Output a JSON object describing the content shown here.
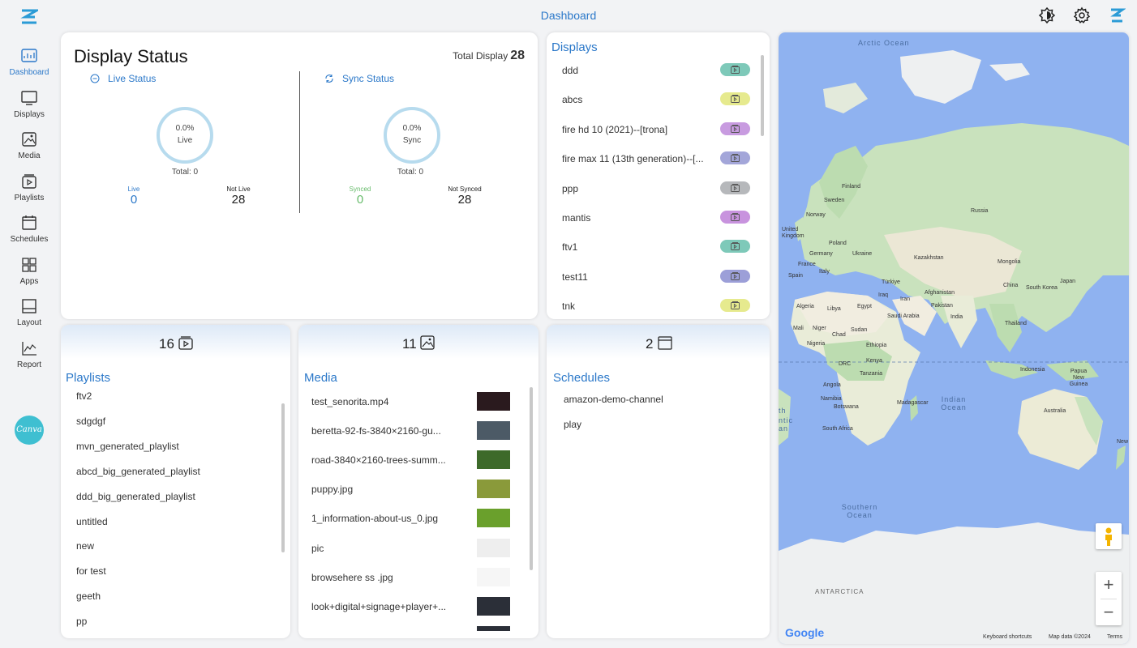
{
  "header": {
    "title": "Dashboard"
  },
  "sidebar": {
    "items": [
      {
        "label": "Dashboard"
      },
      {
        "label": "Displays"
      },
      {
        "label": "Media"
      },
      {
        "label": "Playlists"
      },
      {
        "label": "Schedules"
      },
      {
        "label": "Apps"
      },
      {
        "label": "Layout"
      },
      {
        "label": "Report"
      }
    ],
    "canva_label": "Canva"
  },
  "display_status": {
    "title": "Display Status",
    "total_label": "Total Display",
    "total_value": "28",
    "live": {
      "header": "Live Status",
      "gauge_pct": "0.0%",
      "gauge_label": "Live",
      "total": "Total: 0",
      "stat1_label": "Live",
      "stat1_value": "0",
      "stat2_label": "Not Live",
      "stat2_value": "28"
    },
    "sync": {
      "header": "Sync Status",
      "gauge_pct": "0.0%",
      "gauge_label": "Sync",
      "total": "Total: 0",
      "stat1_label": "Synced",
      "stat1_value": "0",
      "stat2_label": "Not Synced",
      "stat2_value": "28"
    }
  },
  "displays": {
    "title": "Displays",
    "items": [
      {
        "name": "ddd",
        "pill_color": "#7ec9b9"
      },
      {
        "name": "abcs",
        "pill_color": "#e6ea8e"
      },
      {
        "name": "fire hd 10 (2021)--[trona]",
        "pill_color": "#c89be0"
      },
      {
        "name": "fire max 11 (13th generation)--[...",
        "pill_color": "#a3a6d9"
      },
      {
        "name": "ppp",
        "pill_color": "#b6b8bb"
      },
      {
        "name": "mantis",
        "pill_color": "#c893de"
      },
      {
        "name": "ftv1",
        "pill_color": "#7ec9b9"
      },
      {
        "name": "test11",
        "pill_color": "#9c9fd8"
      },
      {
        "name": "tnk",
        "pill_color": "#e6ea8e"
      }
    ]
  },
  "playlists": {
    "count": "16",
    "title": "Playlists",
    "items": [
      "ftv2",
      "sdgdgf",
      "mvn_generated_playlist",
      "abcd_big_generated_playlist",
      "ddd_big_generated_playlist",
      "untitled",
      "new",
      "for test",
      "geeth",
      "pp"
    ]
  },
  "media": {
    "count": "11",
    "title": "Media",
    "items": [
      {
        "name": "test_senorita.mp4",
        "thumb_color": "#2a1a1e"
      },
      {
        "name": "beretta-92-fs-3840×2160-gu...",
        "thumb_color": "#4c5a66"
      },
      {
        "name": "road-3840×2160-trees-summ...",
        "thumb_color": "#3d6a2a"
      },
      {
        "name": "puppy.jpg",
        "thumb_color": "#8a9a3a"
      },
      {
        "name": "1_information-about-us_0.jpg",
        "thumb_color": "#6aa02c"
      },
      {
        "name": "pic",
        "thumb_color": "#eeeeee"
      },
      {
        "name": "browsehere ss .jpg",
        "thumb_color": "#f6f6f6"
      },
      {
        "name": "look+digital+signage+player+...",
        "thumb_color": "#2b2f38"
      }
    ]
  },
  "schedules": {
    "count": "2",
    "title": "Schedules",
    "items": [
      "amazon-demo-channel",
      "play"
    ]
  },
  "map": {
    "labels": {
      "arctic": "Arctic Ocean",
      "indian": "Indian Ocean",
      "southern": "Southern Ocean",
      "antarctica": "ANTARCTICA",
      "finland": "Finland",
      "sweden": "Sweden",
      "norway": "Norway",
      "russia": "Russia",
      "uk": "United Kingdom",
      "poland": "Poland",
      "germany": "Germany",
      "ukraine": "Ukraine",
      "france": "France",
      "italy": "Italy",
      "spain": "Spain",
      "kazakhstan": "Kazakhstan",
      "mongolia": "Mongolia",
      "turkiye": "Türkiye",
      "china": "China",
      "south_korea": "South Korea",
      "japan": "Japan",
      "afghanistan": "Afghanistan",
      "iran": "Iran",
      "iraq": "Iraq",
      "pakistan": "Pakistan",
      "algeria": "Algeria",
      "libya": "Libya",
      "egypt": "Egypt",
      "saudi": "Saudi Arabia",
      "india": "India",
      "thailand": "Thailand",
      "mali": "Mali",
      "niger": "Niger",
      "chad": "Chad",
      "sudan": "Sudan",
      "nigeria": "Nigeria",
      "ethiopia": "Ethiopia",
      "drc": "DRC",
      "kenya": "Kenya",
      "tanzania": "Tanzania",
      "indonesia": "Indonesia",
      "png": "Papua New Guinea",
      "angola": "Angola",
      "namibia": "Namibia",
      "botswana": "Botswana",
      "madagascar": "Madagascar",
      "south_africa": "South Africa",
      "australia": "Australia",
      "new_zealand": "New",
      "atl_th": "th",
      "atl_ntic": "ntic",
      "atl_an": "an"
    },
    "google": "Google",
    "keyboard_shortcuts": "Keyboard shortcuts",
    "map_data": "Map data ©2024",
    "terms": "Terms",
    "zoom_in": "+",
    "zoom_out": "−",
    "colors": {
      "ocean": "#8fb2f0",
      "land": "#e9ecd8",
      "forest": "#bcdcb0",
      "desert": "#f1ede0",
      "ice": "#eef0f1"
    }
  },
  "colors": {
    "accent": "#2b78c9",
    "synced": "#66bb6a",
    "gauge_ring": "#b7dbee"
  }
}
